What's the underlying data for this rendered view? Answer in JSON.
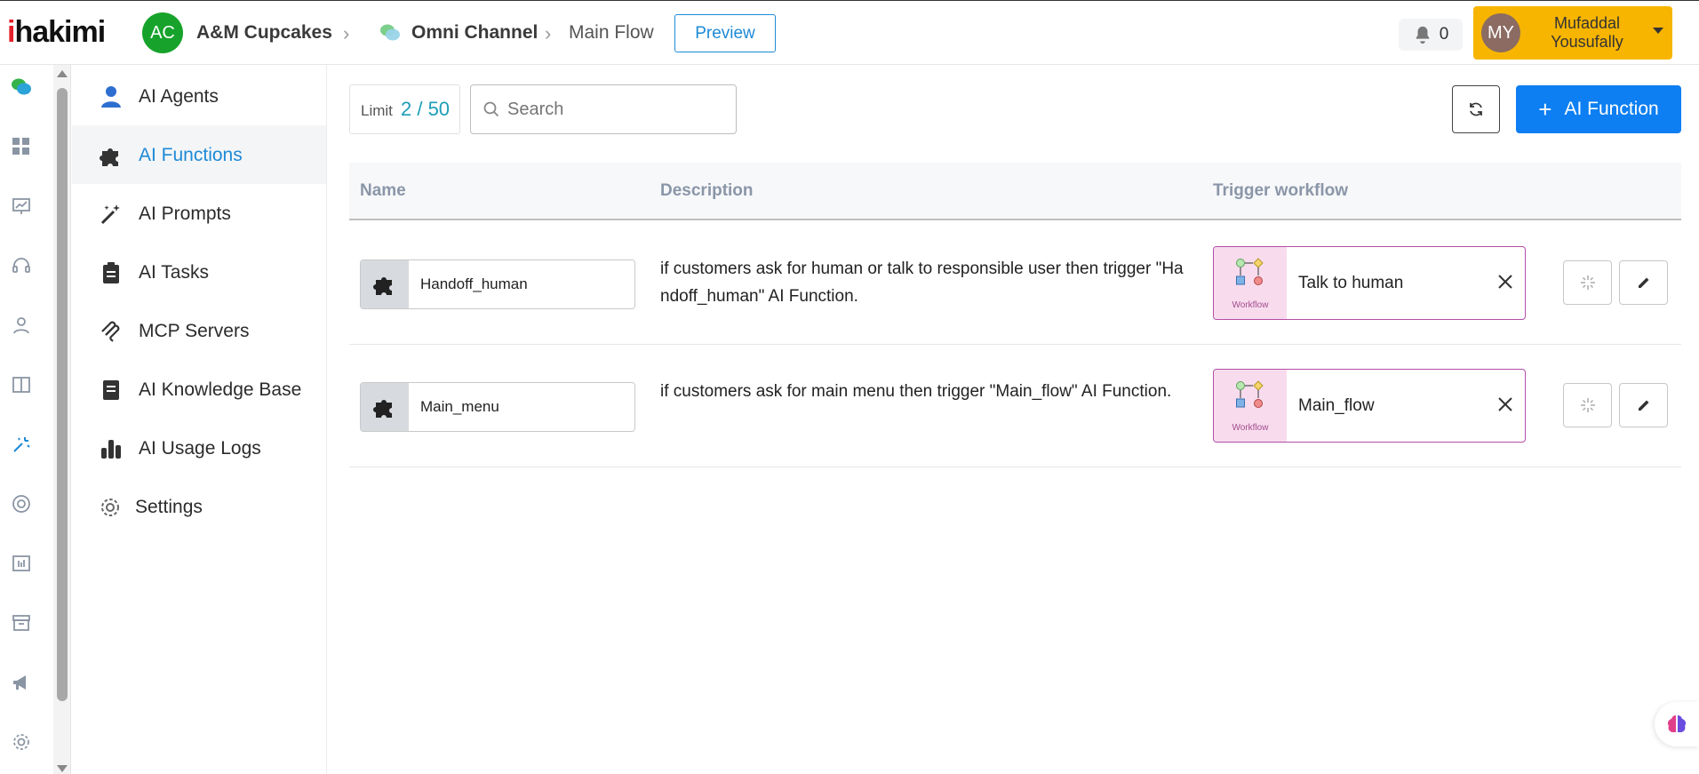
{
  "app": {
    "logo_prefix": "i",
    "logo_rest": "hakimi"
  },
  "breadcrumb": {
    "org_initials": "AC",
    "org_name": "A&M Cupcakes",
    "channel": "Omni Channel",
    "flow": "Main Flow"
  },
  "header": {
    "preview_label": "Preview",
    "notification_count": "0",
    "user_initials": "MY",
    "user_name": "Mufaddal Yousufally"
  },
  "rail": {
    "icons": [
      "chat-bubbles-icon",
      "dashboard-icon",
      "analytics-icon",
      "headset-icon",
      "contacts-icon",
      "book-icon",
      "ai-spark-icon",
      "lifebuoy-icon",
      "report-icon",
      "archive-icon",
      "megaphone-icon",
      "settings-icon"
    ]
  },
  "subnav": {
    "items": [
      {
        "label": "AI Agents",
        "icon": "agent-icon",
        "active": false
      },
      {
        "label": "AI Functions",
        "icon": "puzzle-icon",
        "active": true
      },
      {
        "label": "AI Prompts",
        "icon": "magic-wand-icon",
        "active": false
      },
      {
        "label": "AI Tasks",
        "icon": "clipboard-icon",
        "active": false
      },
      {
        "label": "MCP Servers",
        "icon": "mcp-icon",
        "active": false
      },
      {
        "label": "AI Knowledge Base",
        "icon": "book-icon",
        "active": false
      },
      {
        "label": "AI Usage Logs",
        "icon": "bar-chart-icon",
        "active": false
      },
      {
        "label": "Settings",
        "icon": "gear-icon",
        "active": false
      }
    ]
  },
  "toolbar": {
    "limit_label": "Limit",
    "limit_value": "2 / 50",
    "search_placeholder": "Search",
    "add_label": "AI Function"
  },
  "table": {
    "columns": [
      "Name",
      "Description",
      "Trigger workflow"
    ],
    "rows": [
      {
        "name": "Handoff_human",
        "description": "if customers ask for human or talk to responsible user then trigger \"Handoff_human\" AI Function.",
        "workflow_caption": "Workflow",
        "workflow_name": "Talk to human"
      },
      {
        "name": "Main_menu",
        "description": "if customers ask for main menu then trigger \"Main_flow\" AI Function.",
        "workflow_caption": "Workflow",
        "workflow_name": "Main_flow"
      }
    ]
  },
  "colors": {
    "accent": "#0d7ff2",
    "user_button": "#f7b500",
    "org_avatar": "#17a32b",
    "workflow_border": "#b44ea5"
  }
}
